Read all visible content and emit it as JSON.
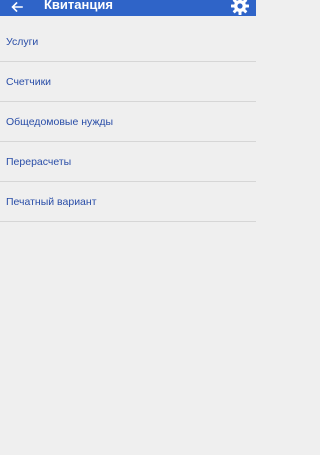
{
  "toolbar": {
    "title": "Квитанция",
    "back_icon": "arrow-left-icon",
    "settings_icon": "gear-icon",
    "background_color": "#2f64c8"
  },
  "menu": {
    "items": [
      {
        "label": "Услуги"
      },
      {
        "label": "Счетчики"
      },
      {
        "label": "Общедомовые нужды"
      },
      {
        "label": "Перерасчеты"
      },
      {
        "label": "Печатный вариант"
      }
    ],
    "text_color": "#2a4ea8"
  }
}
